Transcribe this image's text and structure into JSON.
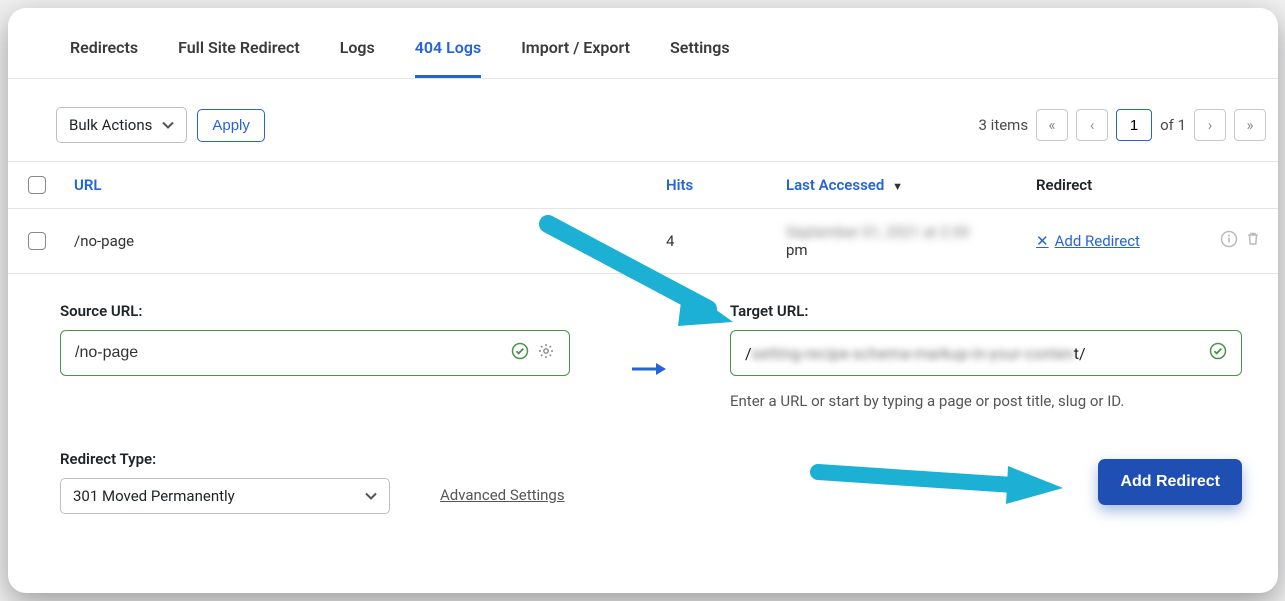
{
  "tabs": {
    "redirects": "Redirects",
    "full_site": "Full Site Redirect",
    "logs": "Logs",
    "logs404": "404 Logs",
    "import_export": "Import / Export",
    "settings": "Settings"
  },
  "toolbar": {
    "bulk_label": "Bulk Actions",
    "apply_label": "Apply",
    "items_count": "3 items",
    "page": "1",
    "of_label": "of 1"
  },
  "columns": {
    "url": "URL",
    "hits": "Hits",
    "last_accessed": "Last Accessed",
    "redirect": "Redirect"
  },
  "rows": [
    {
      "url": "/no-page",
      "hits": "4",
      "last_accessed_blur": "September 01, 2021 at 2:30",
      "last_accessed_suffix": "pm",
      "action": "Add Redirect"
    }
  ],
  "form": {
    "source_label": "Source URL:",
    "source_value": "/no-page",
    "target_label": "Target URL:",
    "target_prefix": "/",
    "target_blur": "setting-recipe-schema-markup-in-your-conten",
    "target_suffix": "t/",
    "target_helper": "Enter a URL or start by typing a page or post title, slug or ID.",
    "type_label": "Redirect Type:",
    "type_value": "301 Moved Permanently",
    "advanced": "Advanced Settings",
    "submit": "Add Redirect"
  }
}
